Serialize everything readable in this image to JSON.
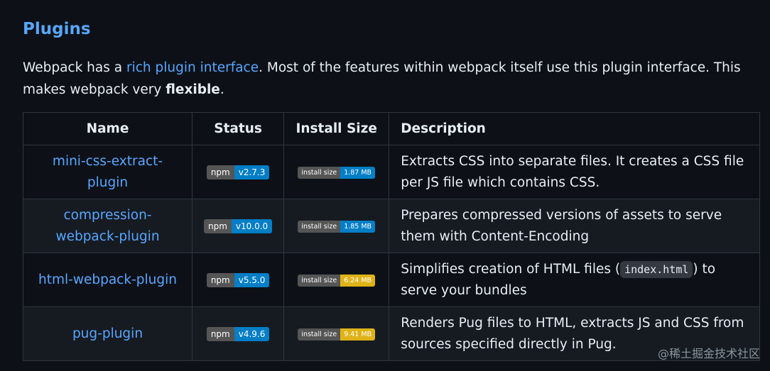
{
  "heading": "Plugins",
  "intro": {
    "before_link": "Webpack has a ",
    "link": "rich plugin interface",
    "after_link": ". Most of the features within webpack itself use this plugin interface. This makes webpack very ",
    "bold": "flexible",
    "end": "."
  },
  "table": {
    "headers": {
      "name": "Name",
      "status": "Status",
      "size": "Install Size",
      "description": "Description"
    },
    "rows": [
      {
        "name": "mini-css-extract-plugin",
        "npm_label": "npm",
        "version": "v2.7.3",
        "size_label": "install size",
        "size": "1.87 MB",
        "size_color": "#007ec6",
        "description": "Extracts CSS into separate files. It creates a CSS file per JS file which contains CSS."
      },
      {
        "name": "compression-webpack-plugin",
        "npm_label": "npm",
        "version": "v10.0.0",
        "size_label": "install size",
        "size": "1.85 MB",
        "size_color": "#007ec6",
        "description": "Prepares compressed versions of assets to serve them with Content-Encoding"
      },
      {
        "name": "html-webpack-plugin",
        "npm_label": "npm",
        "version": "v5.5.0",
        "size_label": "install size",
        "size": "6.24 MB",
        "size_color": "#dfb317",
        "description_before": "Simplifies creation of HTML files (",
        "description_code": "index.html",
        "description_after": ") to serve your bundles"
      },
      {
        "name": "pug-plugin",
        "npm_label": "npm",
        "version": "v4.9.6",
        "size_label": "install size",
        "size": "9.41 MB",
        "size_color": "#dfb317",
        "description": "Renders Pug files to HTML, extracts JS and CSS from sources specified directly in Pug."
      }
    ]
  },
  "watermark": "@稀土掘金技术社区"
}
